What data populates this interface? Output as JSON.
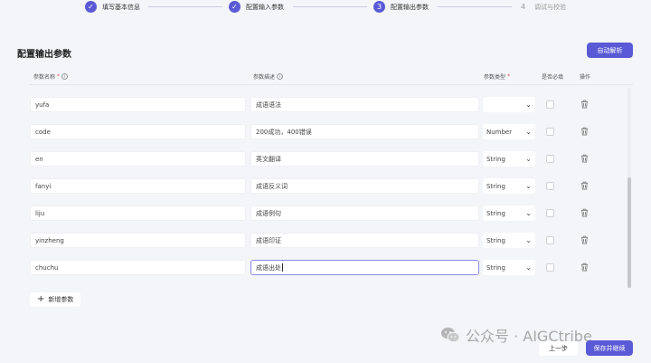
{
  "stepper": {
    "steps": [
      {
        "num": "✓",
        "label": "填写基本信息",
        "state": "done"
      },
      {
        "num": "✓",
        "label": "配置输入参数",
        "state": "done"
      },
      {
        "num": "3",
        "label": "配置输出参数",
        "state": "current"
      },
      {
        "num": "4",
        "label": "调试与校验",
        "state": "pending"
      }
    ]
  },
  "page": {
    "title": "配置输出参数",
    "auto_parse_label": "自动解析"
  },
  "table": {
    "headers": {
      "name": "参数名称",
      "desc": "参数描述",
      "type": "参数类型",
      "required": "是否必填",
      "action": "操作"
    },
    "rows": [
      {
        "name": "yufa",
        "desc": "成语语法",
        "type": ""
      },
      {
        "name": "code",
        "desc": "200成功，400错误",
        "type": "Number"
      },
      {
        "name": "en",
        "desc": "英文翻译",
        "type": "String"
      },
      {
        "name": "fanyi",
        "desc": "成语反义词",
        "type": "String"
      },
      {
        "name": "liju",
        "desc": "成语例句",
        "type": "String"
      },
      {
        "name": "yinzheng",
        "desc": "成语印证",
        "type": "String"
      },
      {
        "name": "chuchu",
        "desc": "成语出处",
        "type": "String"
      }
    ]
  },
  "footer": {
    "add_param_label": "新增参数",
    "prev_label": "上一步",
    "save_label": "保存并继续"
  },
  "watermark": {
    "text": "公众号 · AIGCtribe"
  },
  "colors": {
    "accent": "#5a5ad6",
    "background": "#f4f5f8"
  }
}
